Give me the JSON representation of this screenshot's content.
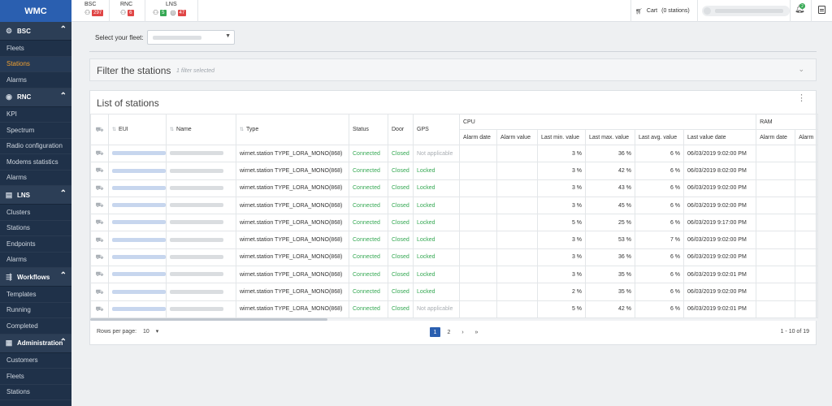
{
  "app": {
    "brand": "WMC"
  },
  "sidebar": {
    "sections": [
      {
        "label": "BSC",
        "icon": "bsc-icon",
        "items": [
          "Fleets",
          "Stations",
          "Alarms"
        ],
        "active": 1
      },
      {
        "label": "RNC",
        "icon": "rnc-icon",
        "items": [
          "KPI",
          "Spectrum",
          "Radio configuration",
          "Modems statistics",
          "Alarms"
        ],
        "active": -1
      },
      {
        "label": "LNS",
        "icon": "lns-icon",
        "items": [
          "Clusters",
          "Stations",
          "Endpoints",
          "Alarms"
        ],
        "active": -1
      },
      {
        "label": "Workflows",
        "icon": "workflows-icon",
        "items": [
          "Templates",
          "Running",
          "Completed"
        ],
        "active": -1
      },
      {
        "label": "Administration",
        "icon": "administration-icon",
        "items": [
          "Customers",
          "Fleets",
          "Stations"
        ],
        "active": -1
      }
    ]
  },
  "topbar": {
    "bsc": {
      "label": "BSC",
      "badge": "297"
    },
    "rnc": {
      "label": "RNC",
      "badge": "6"
    },
    "lns": {
      "label": "LNS",
      "badge_green": "5",
      "badge_red": "47"
    },
    "cart": {
      "label": "Cart",
      "count": "(0 stations)"
    },
    "notifications": "2"
  },
  "fleet": {
    "label": "Select your fleet:"
  },
  "filter": {
    "title": "Filter the stations",
    "subtitle": "1 filter selected"
  },
  "list": {
    "title": "List of stations",
    "group_cpu": "CPU",
    "group_ram": "RAM",
    "columns": {
      "eui": "EUI",
      "name": "Name",
      "type": "Type",
      "status": "Status",
      "door": "Door",
      "gps": "GPS",
      "alarm_date": "Alarm date",
      "alarm_value": "Alarm value",
      "last_min": "Last min. value",
      "last_max": "Last max. value",
      "last_avg": "Last avg. value",
      "last_date": "Last value date",
      "ram_alarm_date": "Alarm date",
      "ram_alarm_value": "Alarm"
    },
    "rows": [
      {
        "type": "wirnet.station TYPE_LORA_MONO(868)",
        "status": "Connected",
        "door": "Closed",
        "gps": "Not applicable",
        "min": "3 %",
        "max": "36 %",
        "avg": "6 %",
        "date": "06/03/2019 9:02:00 PM"
      },
      {
        "type": "wirnet.station TYPE_LORA_MONO(868)",
        "status": "Connected",
        "door": "Closed",
        "gps": "Locked",
        "min": "3 %",
        "max": "42 %",
        "avg": "6 %",
        "date": "06/03/2019 8:02:00 PM"
      },
      {
        "type": "wirnet.station TYPE_LORA_MONO(868)",
        "status": "Connected",
        "door": "Closed",
        "gps": "Locked",
        "min": "3 %",
        "max": "43 %",
        "avg": "6 %",
        "date": "06/03/2019 9:02:00 PM"
      },
      {
        "type": "wirnet.station TYPE_LORA_MONO(868)",
        "status": "Connected",
        "door": "Closed",
        "gps": "Locked",
        "min": "3 %",
        "max": "45 %",
        "avg": "6 %",
        "date": "06/03/2019 9:02:00 PM"
      },
      {
        "type": "wirnet.station TYPE_LORA_MONO(868)",
        "status": "Connected",
        "door": "Closed",
        "gps": "Locked",
        "min": "5 %",
        "max": "25 %",
        "avg": "6 %",
        "date": "06/03/2019 9:17:00 PM"
      },
      {
        "type": "wirnet.station TYPE_LORA_MONO(868)",
        "status": "Connected",
        "door": "Closed",
        "gps": "Locked",
        "min": "3 %",
        "max": "53 %",
        "avg": "7 %",
        "date": "06/03/2019 9:02:00 PM"
      },
      {
        "type": "wirnet.station TYPE_LORA_MONO(868)",
        "status": "Connected",
        "door": "Closed",
        "gps": "Locked",
        "min": "3 %",
        "max": "36 %",
        "avg": "6 %",
        "date": "06/03/2019 9:02:00 PM"
      },
      {
        "type": "wirnet.station TYPE_LORA_MONO(868)",
        "status": "Connected",
        "door": "Closed",
        "gps": "Locked",
        "min": "3 %",
        "max": "35 %",
        "avg": "6 %",
        "date": "06/03/2019 9:02:01 PM"
      },
      {
        "type": "wirnet.station TYPE_LORA_MONO(868)",
        "status": "Connected",
        "door": "Closed",
        "gps": "Locked",
        "min": "2 %",
        "max": "35 %",
        "avg": "6 %",
        "date": "06/03/2019 9:02:00 PM"
      },
      {
        "type": "wirnet.station TYPE_LORA_MONO(868)",
        "status": "Connected",
        "door": "Closed",
        "gps": "Not applicable",
        "min": "5 %",
        "max": "42 %",
        "avg": "6 %",
        "date": "06/03/2019 9:02:01 PM"
      }
    ]
  },
  "pagination": {
    "rows_label": "Rows per page:",
    "rows_value": "10",
    "pages": [
      "1",
      "2"
    ],
    "current": "1",
    "next": "›",
    "last": "»",
    "range": "1 - 10 of 19"
  },
  "colors": {
    "accent": "#2a5fb0",
    "sidebar": "#1f3149",
    "active": "#f0a030",
    "ok": "#35a853",
    "alert": "#e04545"
  }
}
